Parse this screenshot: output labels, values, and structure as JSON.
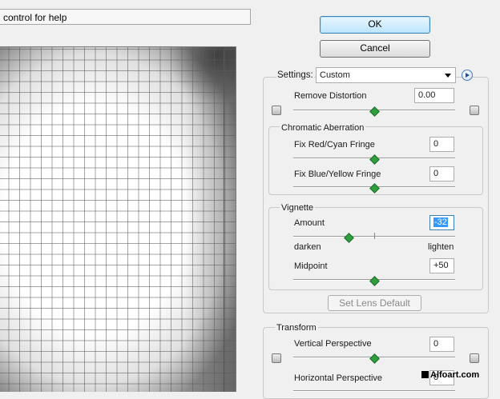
{
  "help_bar": {
    "text": "control for help"
  },
  "buttons": {
    "ok": "OK",
    "cancel": "Cancel",
    "set_lens_default": "Set Lens Default"
  },
  "settings": {
    "label": "Settings:",
    "value": "Custom"
  },
  "remove_distortion": {
    "label": "Remove Distortion",
    "value": "0.00",
    "level": 0.5
  },
  "chromatic_aberration": {
    "title": "Chromatic Aberration",
    "red_cyan": {
      "label": "Fix Red/Cyan Fringe",
      "value": "0"
    },
    "blue_yellow": {
      "label": "Fix Blue/Yellow Fringe",
      "value": "0"
    }
  },
  "vignette": {
    "title": "Vignette",
    "amount": {
      "label": "Amount",
      "value": "-32",
      "left_label": "darken",
      "right_label": "lighten"
    },
    "midpoint": {
      "label": "Midpoint",
      "value": "+50"
    }
  },
  "transform": {
    "title": "Transform",
    "vertical": {
      "label": "Vertical Perspective",
      "value": "0"
    },
    "horizontal": {
      "label": "Horizontal Perspective",
      "value": "0"
    }
  },
  "watermark": "Alfoart.com",
  "colors": {
    "slider_thumb": "#2f9e3c",
    "selection": "#3399ff",
    "ok_border": "#3c7fb1"
  }
}
